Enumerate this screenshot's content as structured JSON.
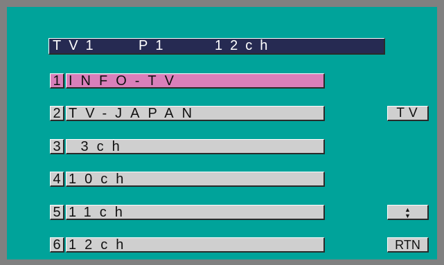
{
  "header": {
    "source": "TV1",
    "preset": "P1",
    "channel": "12ch"
  },
  "presets": [
    {
      "number": "1",
      "label": "INFO-TV",
      "selected": true
    },
    {
      "number": "2",
      "label": "TV-JAPAN",
      "selected": false
    },
    {
      "number": "3",
      "label": " 3ch",
      "selected": false
    },
    {
      "number": "4",
      "label": "10ch",
      "selected": false
    },
    {
      "number": "5",
      "label": "11ch",
      "selected": false
    },
    {
      "number": "6",
      "label": "12ch",
      "selected": false
    }
  ],
  "side_buttons": {
    "tv_label": "TV",
    "updown_icon": "up-down-arrows-icon",
    "updown_glyph": "▲▼",
    "return_label": "RTN"
  },
  "colors": {
    "background": "#00a39a",
    "title_bar": "#262a52",
    "selected": "#d97fba",
    "button": "#cfcfcf"
  }
}
